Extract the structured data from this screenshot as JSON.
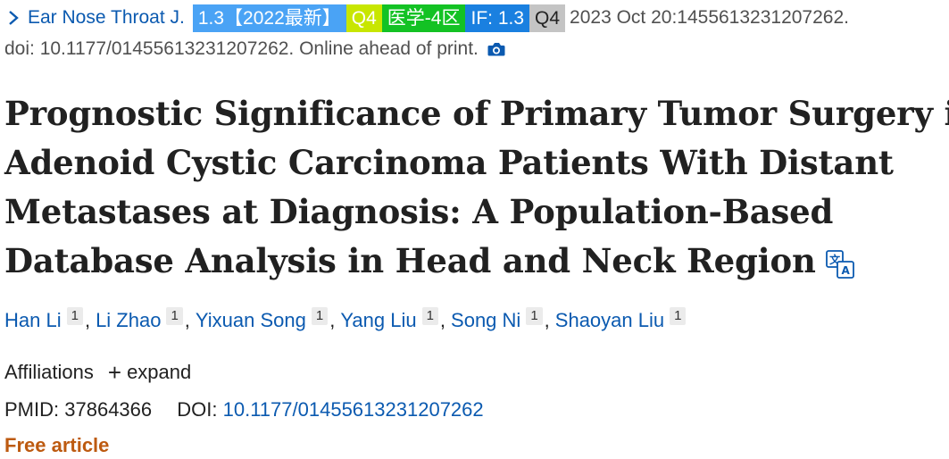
{
  "citation": {
    "journal": "Ear Nose Throat J.",
    "badges": {
      "impact_factor_label": "1.3【2022最新】",
      "quartile_label": "Q4",
      "category_label": "医学-4区",
      "if_label": "IF: 1.3",
      "quartile_gray_label": "Q4"
    },
    "date_text": "2023 Oct 20:1455613231207262.",
    "doi_line": "doi: 10.1177/01455613231207262. Online ahead of print.",
    "colors": {
      "if_badge": "#4aa3f5",
      "quartile_badge": "#c8e600",
      "category_badge": "#13c224",
      "jif_badge": "#1a80e0",
      "quartile_gray_badge": "#c4c4c4"
    }
  },
  "article": {
    "title_lines": [
      "Prognostic Significance of Primary Tumor Surgery in",
      "Adenoid Cystic Carcinoma Patients With Distant",
      "Metastases at Diagnosis: A Population-Based",
      "Database Analysis in Head and Neck Region"
    ]
  },
  "authors": [
    {
      "name": "Han Li",
      "affil": "1"
    },
    {
      "name": "Li Zhao",
      "affil": "1"
    },
    {
      "name": "Yixuan Song",
      "affil": "1"
    },
    {
      "name": "Yang Liu",
      "affil": "1"
    },
    {
      "name": "Song Ni",
      "affil": "1"
    },
    {
      "name": "Shaoyan Liu",
      "affil": "1"
    }
  ],
  "author_separator": ",",
  "affiliations": {
    "label": "Affiliations",
    "expand_label": "expand"
  },
  "identifiers": {
    "pmid_label": "PMID:",
    "pmid": "37864366",
    "doi_label": "DOI:",
    "doi": "10.1177/01455613231207262"
  },
  "access": {
    "free_label": "Free article"
  },
  "icons": [
    "chevron-right-icon",
    "camera-icon",
    "translate-icon"
  ]
}
